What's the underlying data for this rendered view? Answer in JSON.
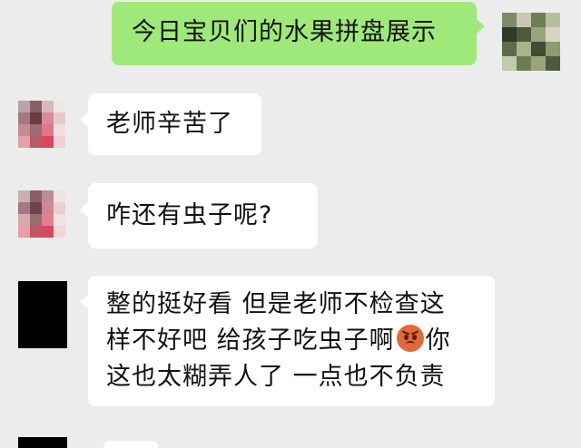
{
  "messages": [
    {
      "direction": "outgoing",
      "text": "今日宝贝们的水果拼盘展示"
    },
    {
      "direction": "incoming",
      "text": "老师辛苦了"
    },
    {
      "direction": "incoming",
      "text": "咋还有虫子呢?"
    },
    {
      "direction": "incoming",
      "lines": [
        "整的挺好看  但是老师不检查这",
        "样不好吧 给孩子吃虫子啊",
        "你",
        "这也太糊弄人了  一点也不负责"
      ],
      "emoji": "angry-face"
    }
  ],
  "avatars": {
    "self": {
      "icon": "pixelated-avatar",
      "colors": [
        "#4b5a3d",
        "#9aa37c",
        "#c9c7b3",
        "#6c7d56",
        "#2f3a29",
        "#a8b38e",
        "#5d6b49",
        "#d7d4c4"
      ]
    },
    "contact_a": {
      "icon": "pixelated-avatar",
      "colors": [
        "#b9a2a6",
        "#8a5f6a",
        "#d98a9a",
        "#6b3b45",
        "#c48c90",
        "#e27684",
        "#9b6b73",
        "#e8c9cb"
      ]
    },
    "contact_b": {
      "icon": "black-avatar",
      "colors": [
        "#000000"
      ]
    }
  },
  "theme": {
    "background": "#ececec",
    "incoming_bubble": "#ffffff",
    "outgoing_bubble": "#9fe87a"
  }
}
